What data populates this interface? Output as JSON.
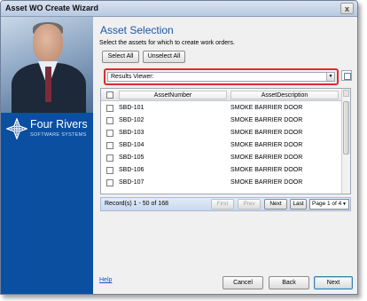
{
  "window": {
    "title": "Asset WO Create Wizard",
    "close_glyph": "x"
  },
  "sidebar": {
    "logo_name": "Four Rivers",
    "logo_subtitle": "SOFTWARE SYSTEMS",
    "logo_icon": "four-rivers-cross-logo"
  },
  "page": {
    "heading": "Asset Selection",
    "instructions": "Select the assets for which to create work orders."
  },
  "selection_buttons": {
    "select_all": "Select All",
    "unselect_all": "Unselect All"
  },
  "results_viewer": {
    "label": "Results Viewer:",
    "value": ""
  },
  "grid": {
    "columns": [
      "AssetNumber",
      "AssetDescription"
    ],
    "rows": [
      {
        "number": "SBD-101",
        "description": "SMOKE BARRIER DOOR"
      },
      {
        "number": "SBD-102",
        "description": "SMOKE BARRIER DOOR"
      },
      {
        "number": "SBD-103",
        "description": "SMOKE BARRIER DOOR"
      },
      {
        "number": "SBD-104",
        "description": "SMOKE BARRIER DOOR"
      },
      {
        "number": "SBD-105",
        "description": "SMOKE BARRIER DOOR"
      },
      {
        "number": "SBD-106",
        "description": "SMOKE BARRIER DOOR"
      },
      {
        "number": "SBD-107",
        "description": "SMOKE BARRIER DOOR"
      }
    ]
  },
  "pager": {
    "records": "Record(s) 1 - 50 of 168",
    "first": "First",
    "prev": "Prev",
    "next": "Next",
    "last": "Last",
    "page": "Page 1 of 4"
  },
  "footer": {
    "help": "Help",
    "cancel": "Cancel",
    "back": "Back",
    "next": "Next"
  },
  "colors": {
    "accent": "#1a57a8",
    "sidebar": "#0b4fa1",
    "highlight": "#e02b2b"
  }
}
